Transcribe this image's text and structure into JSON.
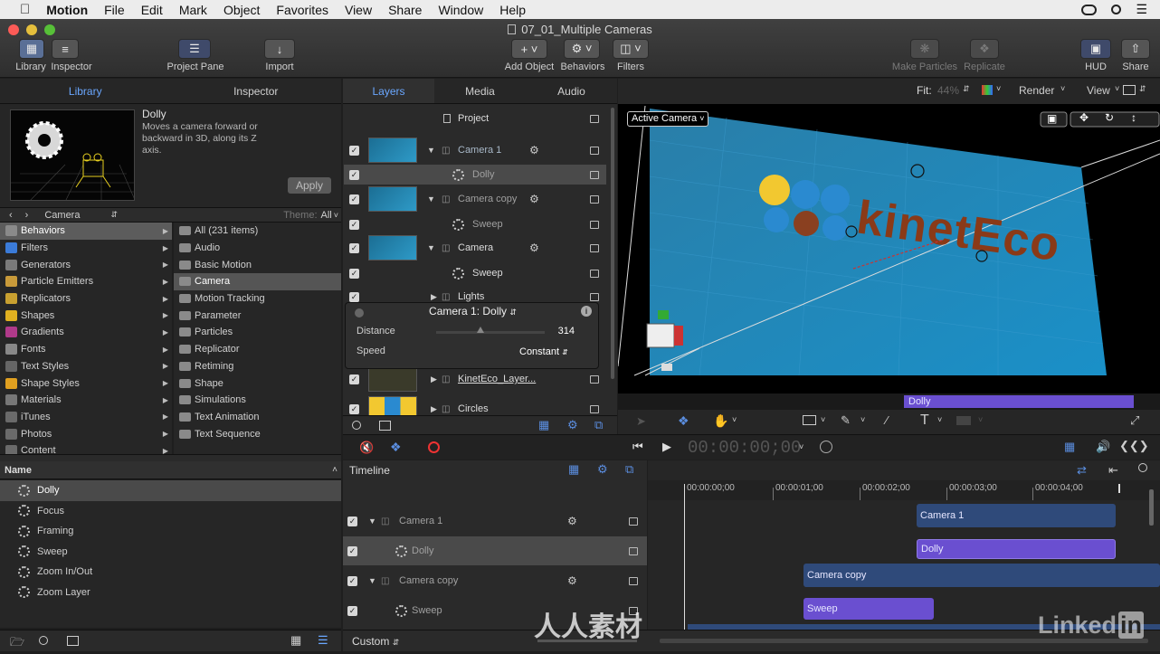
{
  "menubar": {
    "app": "Motion",
    "items": [
      "File",
      "Edit",
      "Mark",
      "Object",
      "Favorites",
      "View",
      "Share",
      "Window",
      "Help"
    ]
  },
  "window": {
    "title": "07_01_Multiple Cameras"
  },
  "toolbar": {
    "library": "Library",
    "inspector": "Inspector",
    "project_pane": "Project Pane",
    "import": "Import",
    "add_object": "Add Object",
    "behaviors": "Behaviors",
    "filters": "Filters",
    "make_particles": "Make Particles",
    "replicate": "Replicate",
    "hud": "HUD",
    "share": "Share"
  },
  "left_tabs": {
    "library": "Library",
    "inspector": "Inspector"
  },
  "preview": {
    "title": "Dolly",
    "description": "Moves a camera forward or backward in 3D, along its Z axis.",
    "apply": "Apply"
  },
  "browser_nav": {
    "path": "Camera",
    "theme_label": "Theme:",
    "theme_value": "All"
  },
  "categories": [
    {
      "label": "Behaviors",
      "color": "#8a8a8a"
    },
    {
      "label": "Filters",
      "color": "#3b7bd8"
    },
    {
      "label": "Generators",
      "color": "#7a7a7a"
    },
    {
      "label": "Particle Emitters",
      "color": "#c89a3a"
    },
    {
      "label": "Replicators",
      "color": "#c8a030"
    },
    {
      "label": "Shapes",
      "color": "#e0b020"
    },
    {
      "label": "Gradients",
      "color": "#b03a8a"
    },
    {
      "label": "Fonts",
      "color": "#888888"
    },
    {
      "label": "Text Styles",
      "color": "#666666"
    },
    {
      "label": "Shape Styles",
      "color": "#e0a020"
    },
    {
      "label": "Materials",
      "color": "#777777"
    },
    {
      "label": "iTunes",
      "color": "#6a6a6a"
    },
    {
      "label": "Photos",
      "color": "#6a6a6a"
    },
    {
      "label": "Content",
      "color": "#6a6a6a"
    }
  ],
  "subcategories": [
    "All (231 items)",
    "Audio",
    "Basic Motion",
    "Camera",
    "Motion Tracking",
    "Parameter",
    "Particles",
    "Replicator",
    "Retiming",
    "Shape",
    "Simulations",
    "Text Animation",
    "Text Sequence"
  ],
  "name_list": {
    "header": "Name",
    "items": [
      "Dolly",
      "Focus",
      "Framing",
      "Sweep",
      "Zoom In/Out",
      "Zoom Layer"
    ]
  },
  "layers_tabs": {
    "layers": "Layers",
    "media": "Media",
    "audio": "Audio"
  },
  "layers": {
    "project": "Project",
    "rows": [
      "Camera 1",
      "Dolly",
      "Camera copy",
      "Sweep",
      "Camera",
      "Sweep",
      "Lights",
      "KinetEco_Layer...",
      "Circles"
    ]
  },
  "hud": {
    "title": "Camera 1: Dolly",
    "distance_label": "Distance",
    "distance_value": "314",
    "speed_label": "Speed",
    "speed_value": "Constant"
  },
  "canvas": {
    "fit_label": "Fit:",
    "fit_value": "44%",
    "render": "Render",
    "view": "View",
    "active_camera": "Active Camera",
    "logo_text": "kinetEco",
    "timebar_clip": "Dolly"
  },
  "transport": {
    "timecode": "00:00:00;00"
  },
  "timeline": {
    "title": "Timeline",
    "ruler": [
      "00:00:00;00",
      "00:00:01;00",
      "00:00:02;00",
      "00:00:03;00",
      "00:00:04;00"
    ],
    "rows": [
      "Camera 1",
      "Dolly",
      "Camera copy",
      "Sweep"
    ],
    "clips": [
      "Camera 1",
      "Dolly",
      "Camera copy",
      "Sweep"
    ],
    "footer": "Custom"
  },
  "watermark": {
    "linkedin": "Linked",
    "in": "in",
    "cn": "人人素材"
  },
  "colors": {
    "accent": "#6aa7ff",
    "clip_camera": "#2f4a7a",
    "clip_behavior": "#6a4fd0"
  }
}
